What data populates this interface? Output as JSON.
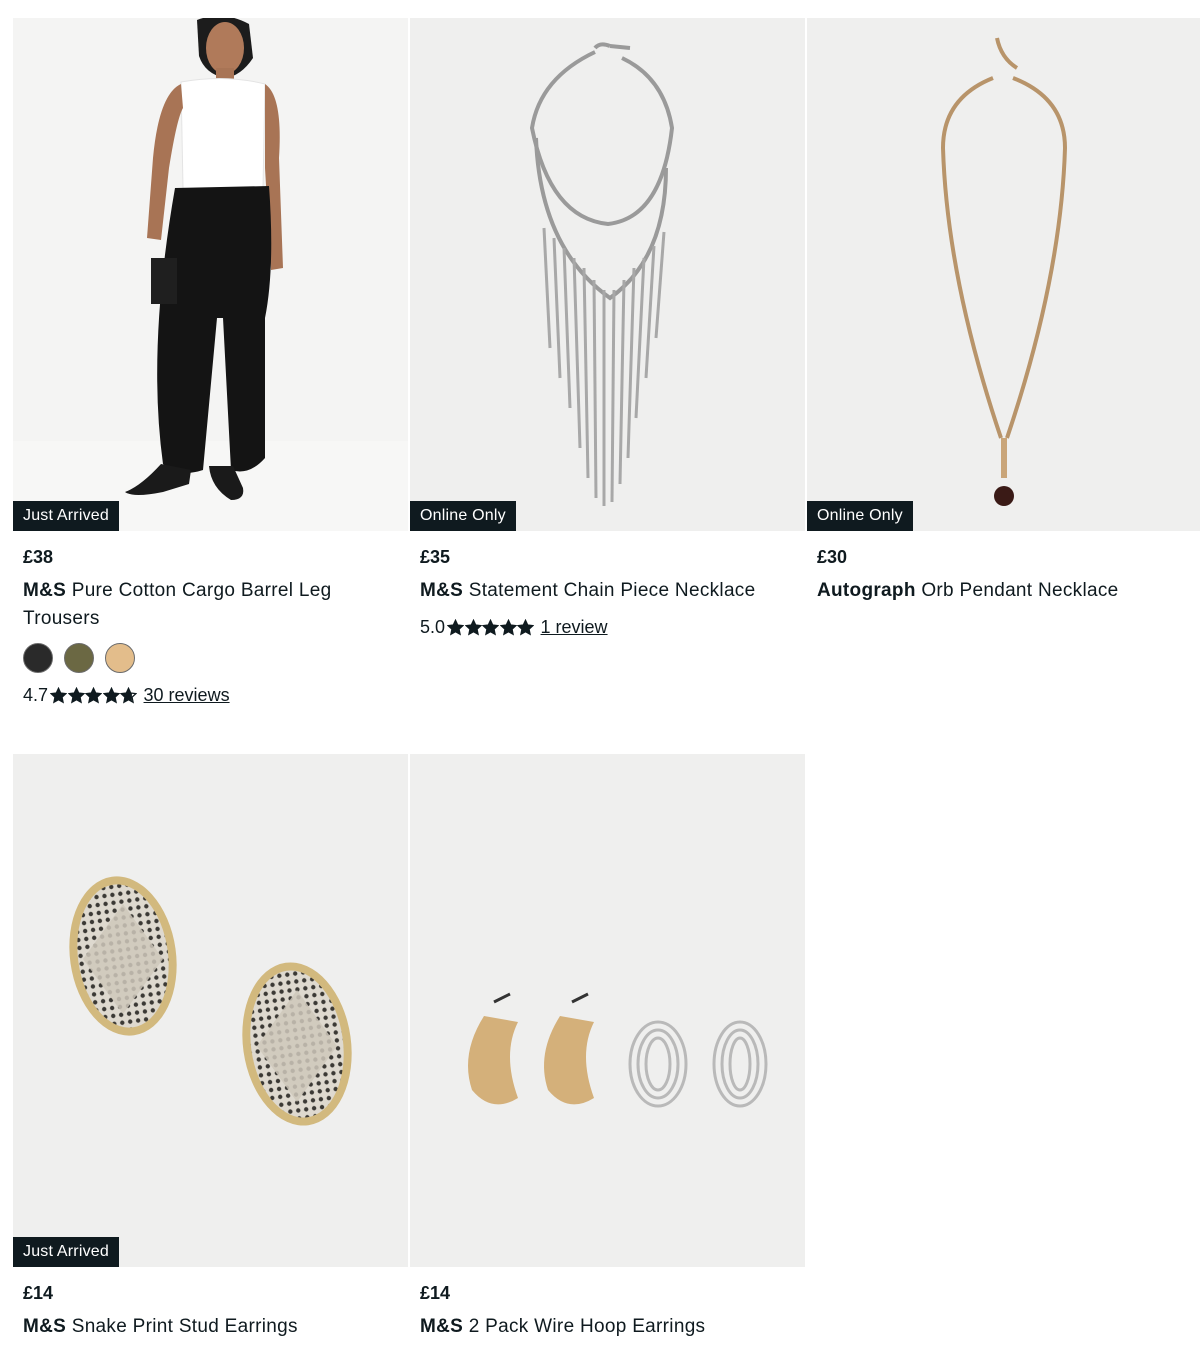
{
  "products": [
    {
      "badge": "Just Arrived",
      "price": "£38",
      "brand": "M&S",
      "name": "Pure Cotton Cargo Barrel Leg Trousers",
      "swatches": [
        "#2a2a2a",
        "#6b6843",
        "#e3bd8b"
      ],
      "rating": "4.7",
      "rating_value": 4.7,
      "reviews": "30 reviews"
    },
    {
      "badge": "Online Only",
      "price": "£35",
      "brand": "M&S",
      "name": "Statement Chain Piece Necklace",
      "rating": "5.0",
      "rating_value": 5,
      "reviews": "1 review"
    },
    {
      "badge": "Online Only",
      "price": "£30",
      "brand": "Autograph",
      "name": "Orb Pendant Necklace"
    },
    {
      "badge": "Just Arrived",
      "price": "£14",
      "brand": "M&S",
      "name": "Snake Print Stud Earrings"
    },
    {
      "price": "£14",
      "brand": "M&S",
      "name": "2 Pack Wire Hoop Earrings"
    }
  ],
  "colors": {
    "badge_bg": "#0f1a1f",
    "image_bg": "#efefee",
    "text": "#0f1a1f"
  }
}
